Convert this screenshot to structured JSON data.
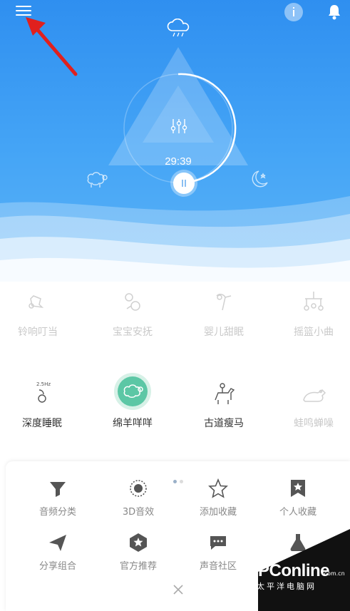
{
  "player": {
    "timer": "29:39",
    "weather_icon": "rain-cloud-icon",
    "left_scene_icon": "sheep-icon",
    "right_scene_icon": "moon-icon"
  },
  "sounds": [
    {
      "label": "铃响叮当",
      "icon": "bell-ring-icon",
      "active": false
    },
    {
      "label": "宝宝安抚",
      "icon": "baby-soothe-icon",
      "active": false
    },
    {
      "label": "婴儿甜眠",
      "icon": "baby-sleep-icon",
      "active": false
    },
    {
      "label": "摇篮小曲",
      "icon": "cradle-mobile-icon",
      "active": false
    },
    {
      "label": "深度睡眠",
      "icon": "deep-sleep-icon",
      "active": true,
      "badge": "2.5Hz"
    },
    {
      "label": "绵羊咩咩",
      "icon": "sheep-icon",
      "active": true,
      "selected": true
    },
    {
      "label": "古道瘦马",
      "icon": "horse-rider-icon",
      "active": true
    },
    {
      "label": "蛙鸣蝉噪",
      "icon": "frog-icon",
      "active": false
    }
  ],
  "menu": [
    {
      "label": "音频分类",
      "icon": "filter-icon"
    },
    {
      "label": "3D音效",
      "icon": "3d-sound-icon"
    },
    {
      "label": "添加收藏",
      "icon": "star-outline-icon"
    },
    {
      "label": "个人收藏",
      "icon": "bookmark-star-icon"
    },
    {
      "label": "分享组合",
      "icon": "paper-plane-icon"
    },
    {
      "label": "官方推荐",
      "icon": "badge-star-icon"
    },
    {
      "label": "声音社区",
      "icon": "chat-bubble-icon"
    },
    {
      "label": "",
      "icon": "flask-icon"
    }
  ],
  "watermark": {
    "brand": "PConline",
    "sub": "太平洋电脑网",
    "domain": ".com.cn"
  },
  "colors": {
    "hero_blue": "#2f8ff0",
    "arrow_red": "#e0201e",
    "accent_green": "#5cc7a5"
  }
}
